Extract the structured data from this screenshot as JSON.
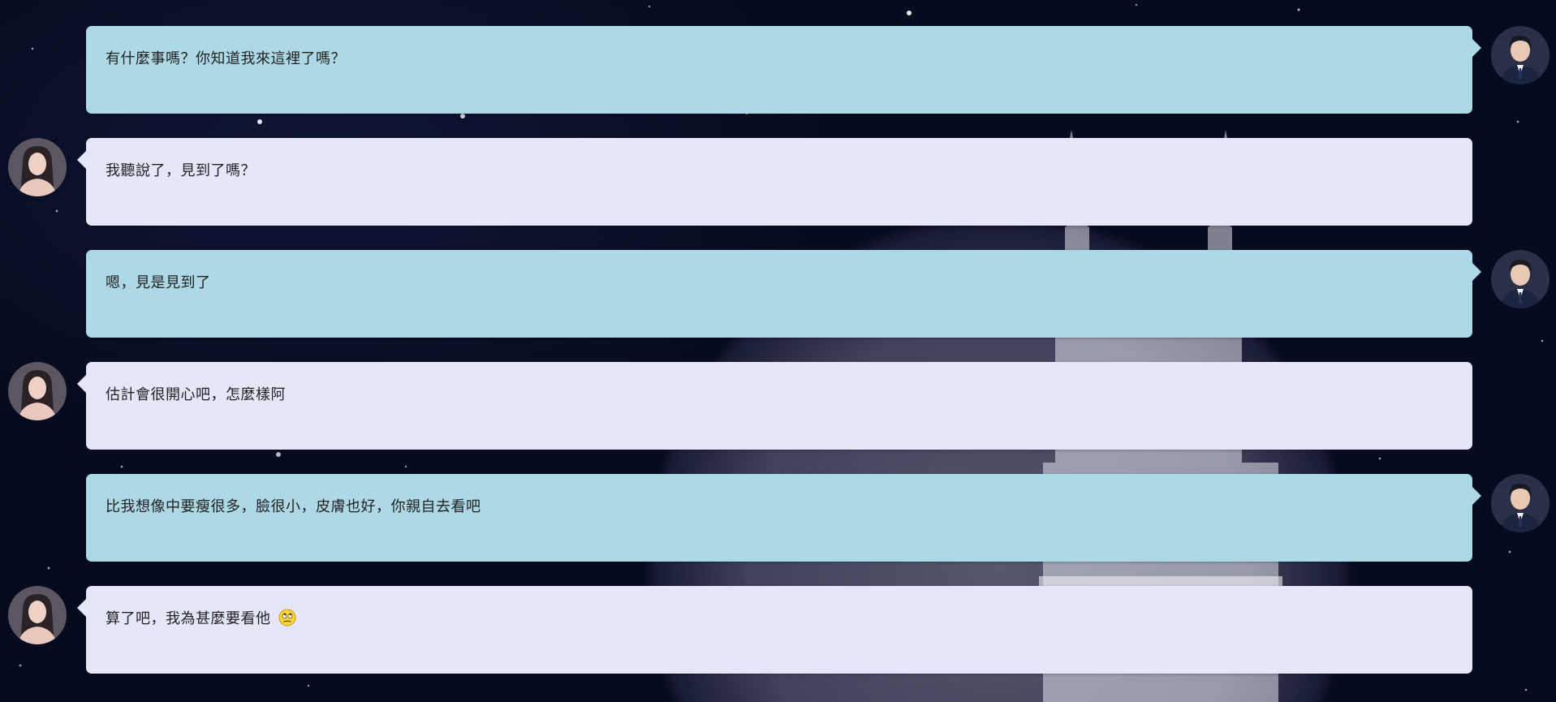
{
  "messages": [
    {
      "side": "right",
      "text": "有什麼事嗎？你知道我來這裡了嗎？",
      "avatar": "male-avatar"
    },
    {
      "side": "left",
      "text": "我聽說了，見到了嗎？",
      "avatar": "female-avatar"
    },
    {
      "side": "right",
      "text": "嗯，見是見到了",
      "avatar": "male-avatar"
    },
    {
      "side": "left",
      "text": "估計會很開心吧，怎麼樣阿",
      "avatar": "female-avatar"
    },
    {
      "side": "right",
      "text": "比我想像中要瘦很多，臉很小，皮膚也好，你親自去看吧",
      "avatar": "male-avatar"
    },
    {
      "side": "left",
      "text": "算了吧，我為甚麼要看他",
      "avatar": "female-avatar",
      "emoji": "eye-roll-emoji-icon"
    }
  ],
  "colors": {
    "right_bubble": "#add8e6",
    "left_bubble": "#e6e6fa",
    "background": "#060a1c"
  }
}
